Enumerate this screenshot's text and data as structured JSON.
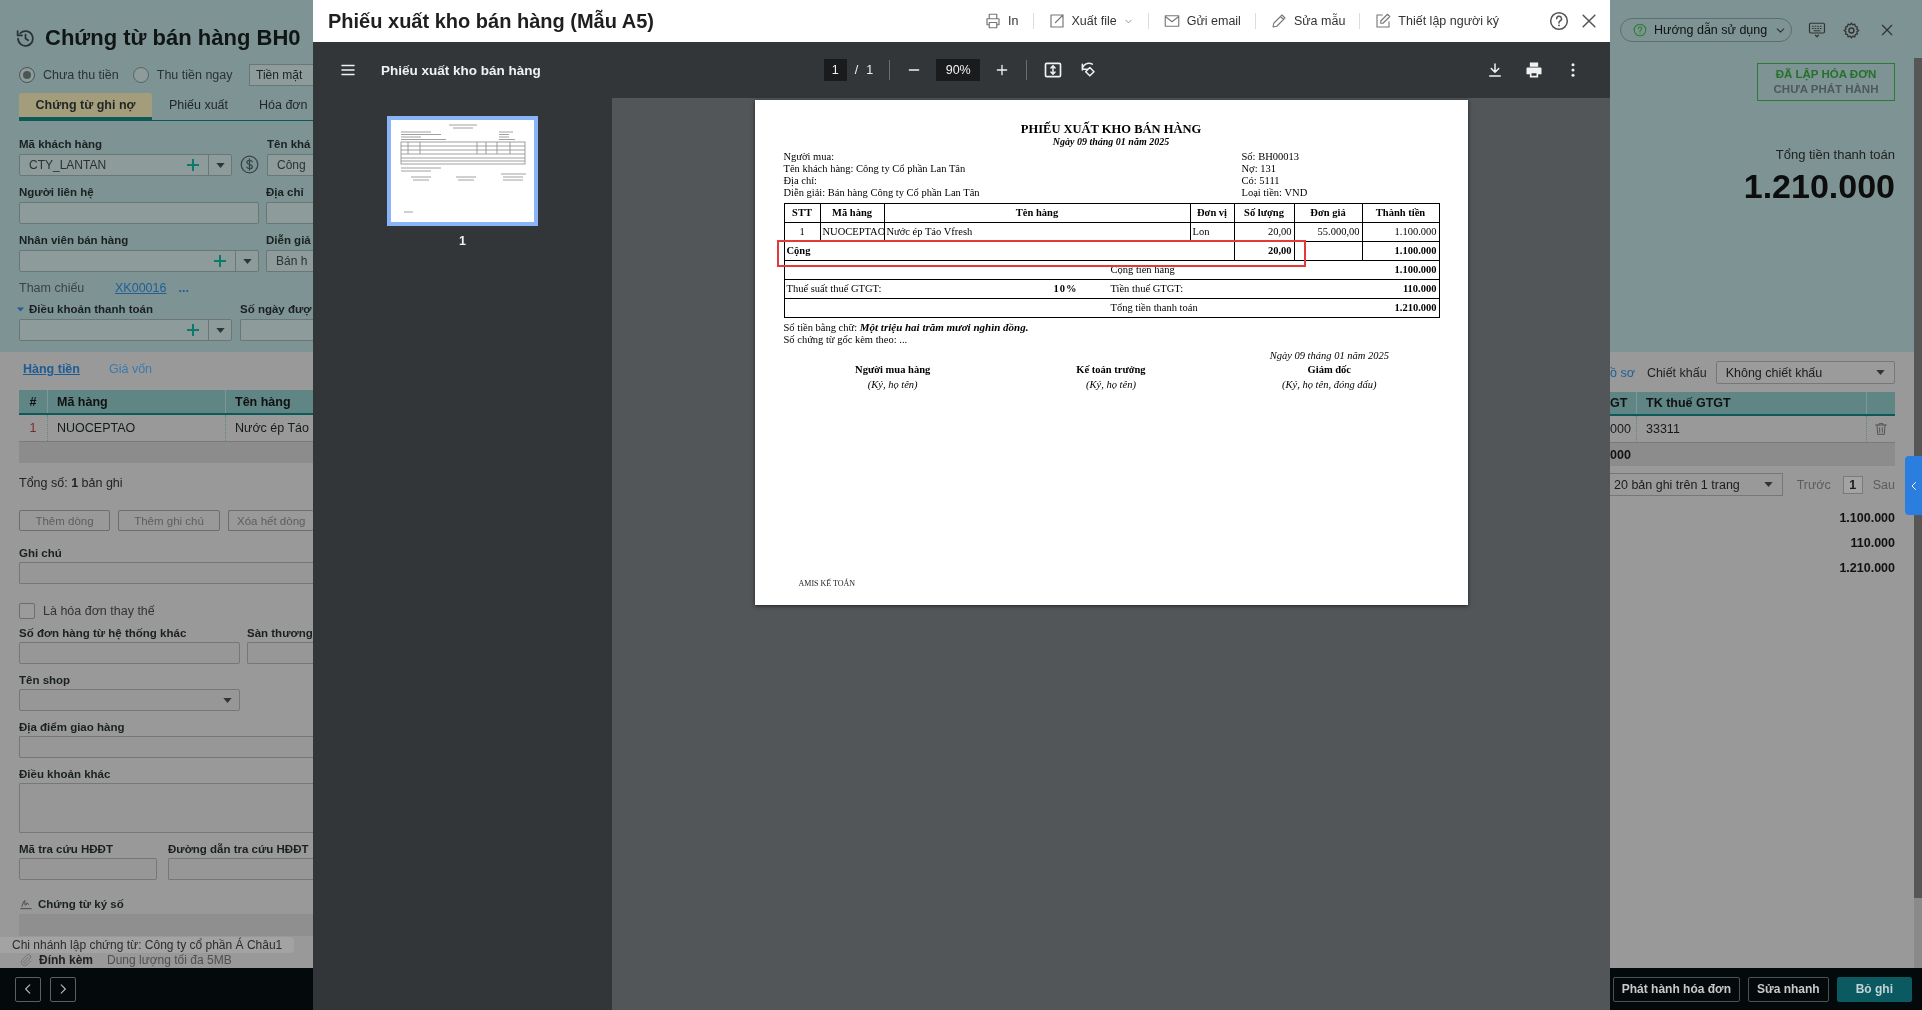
{
  "form": {
    "title": "Chứng từ bán hàng BH0",
    "payment_options": [
      {
        "label": "Chưa thu tiền",
        "selected": true
      },
      {
        "label": "Thu tiền ngay",
        "selected": false
      }
    ],
    "payment_method": "Tiền mặt",
    "tabs": [
      {
        "label": "Chứng từ ghi nợ",
        "selected": true
      },
      {
        "label": "Phiếu xuất",
        "selected": false
      },
      {
        "label": "Hóa đơn",
        "selected": false
      }
    ],
    "customer_code": {
      "label": "Mã khách hàng",
      "value": "CTY_LANTAN"
    },
    "customer_name": {
      "label": "Tên khá",
      "value": "Công"
    },
    "contact": {
      "label": "Người liên hệ"
    },
    "address": {
      "label": "Địa chỉ"
    },
    "salesperson": {
      "label": "Nhân viên bán hàng"
    },
    "description": {
      "label": "Diễn giả",
      "value": "Bán h"
    },
    "reference": {
      "label": "Tham chiếu",
      "link": "XK00016",
      "more": "..."
    },
    "payment_terms": {
      "label": "Điều khoản thanh toán",
      "expanded": true
    },
    "due_days": {
      "label": "Số ngày đượ"
    },
    "detail_tabs": [
      {
        "label": "Hàng tiền",
        "selected": true
      },
      {
        "label": "Giá vốn",
        "selected": false
      }
    ],
    "items_table": {
      "columns": [
        "#",
        "Mã hàng",
        "Tên hàng"
      ],
      "rows": [
        [
          "1",
          "NUOCEPTAO",
          "Nước ép Táo"
        ]
      ]
    },
    "record_count": "Tổng số: **1** bản ghi",
    "row_buttons": [
      "Thêm dòng",
      "Thêm ghi chú",
      "Xóa hết dòng"
    ],
    "note": {
      "label": "Ghi chú"
    },
    "replacement_invoice": {
      "label": "Là hóa đơn thay thế",
      "checked": false
    },
    "external_order": {
      "label": "Số đơn hàng từ hệ thống khác"
    },
    "marketplace": {
      "label": "Sàn thương"
    },
    "shop": {
      "label": "Tên shop"
    },
    "delivery_place": {
      "label": "Địa điểm giao hàng"
    },
    "other_terms": {
      "label": "Điều khoản khác"
    },
    "einvoice_code": {
      "label": "Mã tra cứu HĐĐT"
    },
    "einvoice_link": {
      "label": "Đường dẫn tra cứu HĐĐT"
    },
    "signed_documents": {
      "label": "Chứng từ ký số"
    },
    "branch_note": "Chi nhánh lập chứng từ: Công ty cổ phần Á Châu1",
    "attachments": {
      "label": "Đính kèm",
      "hint": "Dung lượng tối đa 5MB"
    }
  },
  "side_panel": {
    "help_button": "Hướng dẫn sử dụng",
    "status_stamp": {
      "done": "ĐÃ LẬP HÓA ĐƠN",
      "pending": "CHƯA PHÁT HÀNH"
    },
    "total_label": "Tổng tiền thanh toán",
    "total_value": "1.210.000",
    "records_link": "ồ sơ",
    "discount": {
      "label": "Chiết khấu",
      "value": "Không chiết khấu"
    },
    "table": {
      "columns": [
        "GT",
        "TK thuế GTGT"
      ],
      "rows": [
        [
          "000",
          "33311"
        ]
      ],
      "summary": [
        "000"
      ]
    },
    "pagination": {
      "page_size": "20 bản ghi trên 1 trang",
      "prev": "Trước",
      "page": "1",
      "next": "Sau"
    },
    "totals": [
      "1.100.000",
      "110.000",
      "1.210.000"
    ]
  },
  "bottom_bar": {
    "actions": [
      {
        "label": "Phát hành hóa đơn",
        "kind": "outline"
      },
      {
        "label": "Sửa nhanh",
        "kind": "outline"
      },
      {
        "label": "Bỏ ghi",
        "kind": "primary"
      }
    ]
  },
  "preview_dialog": {
    "title": "Phiếu xuất kho bán hàng (Mẫu A5)",
    "actions": [
      {
        "label": "In",
        "kind": "print",
        "dropdown": false
      },
      {
        "label": "Xuất file",
        "kind": "export",
        "dropdown": true
      },
      {
        "label": "Gửi email",
        "kind": "email",
        "dropdown": false
      },
      {
        "label": "Sửa mẫu",
        "kind": "edit",
        "dropdown": false
      },
      {
        "label": "Thiết lập người ký",
        "kind": "signer",
        "dropdown": false
      }
    ],
    "viewer": {
      "file_name": "Phiếu xuất kho bán hàng",
      "page": "1",
      "separator": "/",
      "page_count": "1",
      "zoom": "90%"
    },
    "thumbnails": [
      {
        "label": "1",
        "selected": true
      }
    ],
    "document": {
      "title": "PHIẾU XUẤT KHO BÁN HÀNG",
      "date": "Ngày 09 tháng 01 năm 2025",
      "info_left": [
        "Người mua:",
        "Tên khách hàng: Công ty Cổ phần Lan Tân",
        "Địa chỉ:",
        "Diễn giải: Bán hàng Công ty Cổ phần Lan Tân"
      ],
      "info_right": [
        "Số: BH00013",
        "Nợ: 131",
        "Có: 5111",
        "Loại tiền: VND"
      ],
      "table": {
        "columns": [
          "STT",
          "Mã hàng",
          "Tên hàng",
          "Đơn vị",
          "Số lượng",
          "Đơn giá",
          "Thành tiền"
        ],
        "rows": [
          [
            "1",
            "NUOCEPTAO",
            "Nước ép Táo Vfresh",
            "Lon",
            "20,00",
            "55.000,00",
            "1.100.000"
          ]
        ],
        "total_row": {
          "label": "Cộng",
          "quantity": "20,00",
          "amount": "1.100.000",
          "highlighted": true
        }
      },
      "summary": {
        "goods_label": "Cộng tiền hàng",
        "goods_value": "1.100.000",
        "vat_rate_label": "Thuế suất thuế GTGT:",
        "vat_rate": "10%",
        "vat_label": "Tiền thuế GTGT:",
        "vat_value": "110.000",
        "grand_label": "Tổng tiền thanh toán",
        "grand_value": "1.210.000"
      },
      "amount_in_words": "Số tiền bằng chữ: **Một triệu hai trăm mươi nghìn đồng.**",
      "attachments_line": "Số chứng từ gốc kèm theo: ...",
      "sign_date": "Ngày 09 tháng 01 năm 2025",
      "signatures": [
        {
          "role": "Người mua hàng",
          "note": "(Ký, họ tên)"
        },
        {
          "role": "Kế toán trưởng",
          "note": "(Ký, họ tên)"
        },
        {
          "role": "Giám đốc",
          "note": "(Ký, họ tên, đóng dấu)"
        }
      ],
      "footer": "AMIS KẾ TOÁN"
    }
  }
}
